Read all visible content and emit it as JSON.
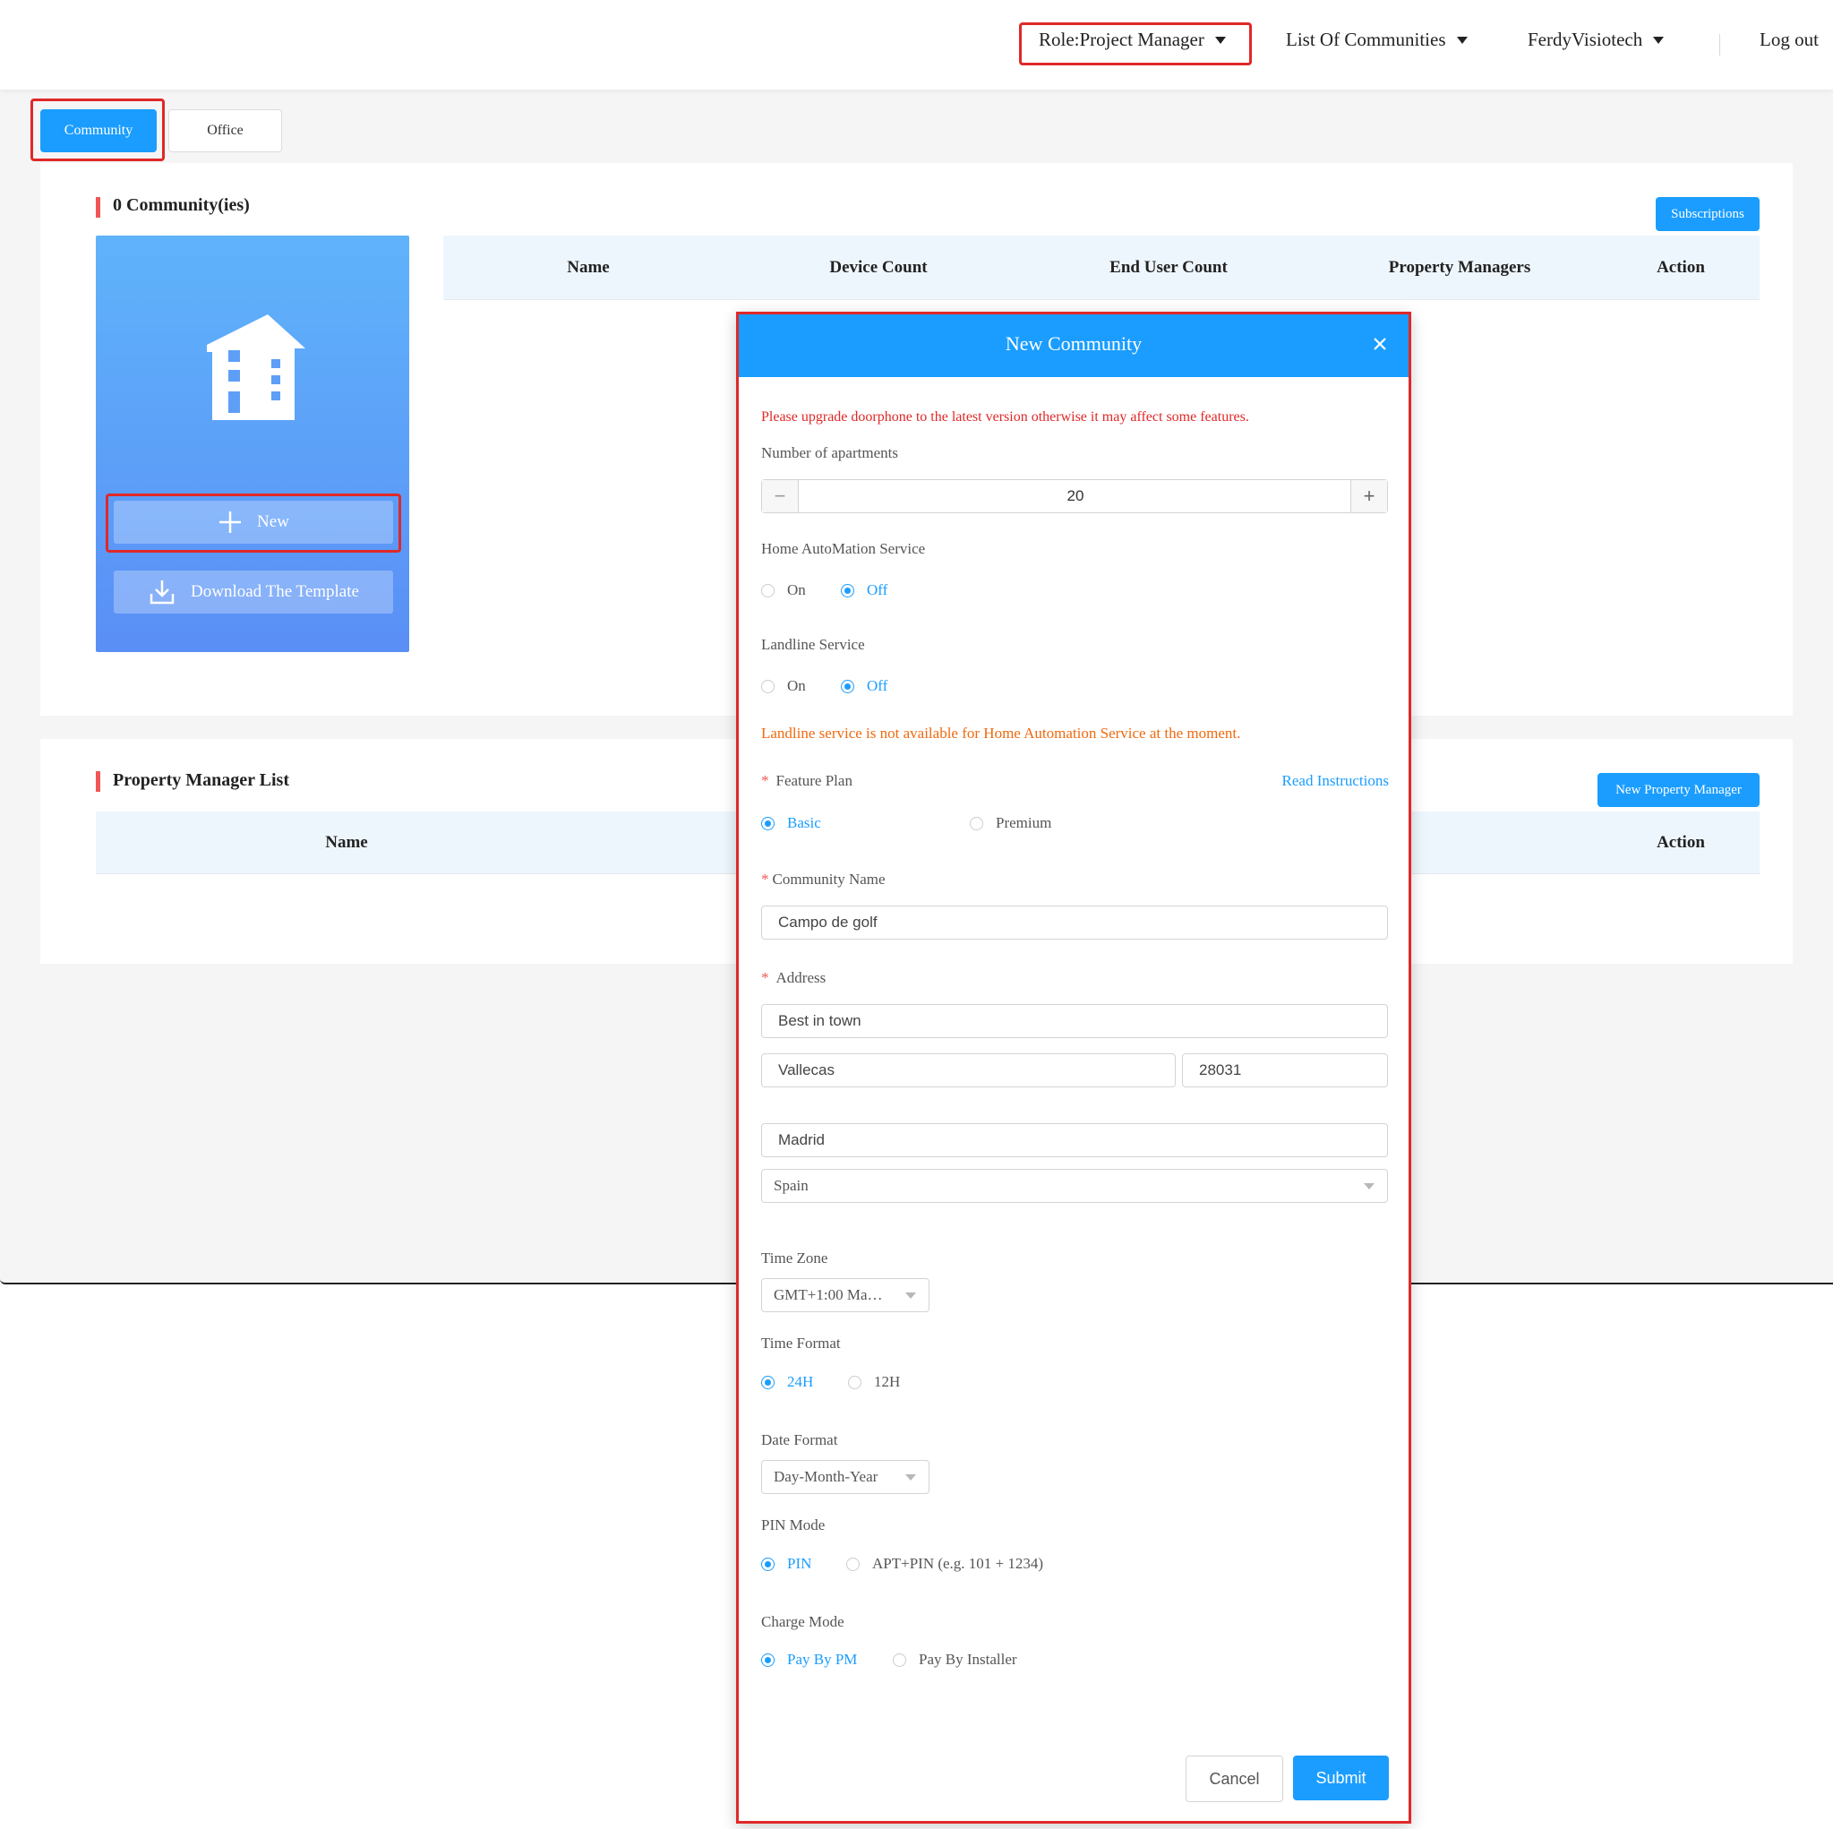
{
  "topbar": {
    "role": "Role:Project Manager",
    "communities_menu": "List Of Communities",
    "user_menu": "FerdyVisiotech",
    "logout": "Log out"
  },
  "tabs": {
    "community": "Community",
    "office": "Office"
  },
  "community_section": {
    "title": "0 Community(ies)",
    "subscriptions_button": "Subscriptions",
    "new_button": "New",
    "download_button": "Download The Template",
    "columns": [
      "Name",
      "Device Count",
      "End User Count",
      "Property Managers",
      "Action"
    ]
  },
  "pm_section": {
    "title": "Property Manager List",
    "new_pm_button": "New Property Manager",
    "columns": [
      "Name",
      "Action"
    ]
  },
  "modal": {
    "title": "New Community",
    "warning": "Please upgrade doorphone to the latest version otherwise it may affect some features.",
    "apartments_label": "Number of apartments",
    "apartments_value": "20",
    "home_automation_label": "Home AutoMation Service",
    "landline_label": "Landline Service",
    "on_label": "On",
    "off_label": "Off",
    "landline_note": "Landline service is not available for Home Automation Service at the moment.",
    "feature_plan_label": "Feature Plan",
    "read_instructions": "Read Instructions",
    "plan_basic": "Basic",
    "plan_premium": "Premium",
    "community_name_label": "Community Name",
    "community_name_value": "Campo de golf",
    "address_label": "Address",
    "address_value": "Best in town",
    "city_value": "Vallecas",
    "postal_value": "28031",
    "region_value": "Madrid",
    "country_value": "Spain",
    "timezone_label": "Time Zone",
    "timezone_value": "GMT+1:00 Ma…",
    "time_format_label": "Time Format",
    "tf_24": "24H",
    "tf_12": "12H",
    "date_format_label": "Date Format",
    "date_format_value": "Day-Month-Year",
    "pin_mode_label": "PIN Mode",
    "pin_pin": "PIN",
    "pin_apt": "APT+PIN (e.g. 101 + 1234)",
    "charge_mode_label": "Charge Mode",
    "charge_pm": "Pay By PM",
    "charge_installer": "Pay By Installer",
    "cancel": "Cancel",
    "submit": "Submit"
  },
  "colors": {
    "accent": "#1a9dff",
    "highlight": "#e02828",
    "warning_red": "#e02828",
    "note_orange": "#f06a0f",
    "section_mark": "#f05656"
  },
  "icons": [
    "caret-down-icon",
    "building-icon",
    "plus-icon",
    "download-icon",
    "close-icon",
    "minus-icon"
  ]
}
